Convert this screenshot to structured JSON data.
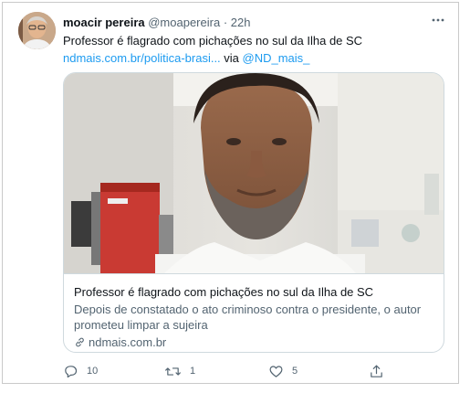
{
  "tweet": {
    "author_name": "moacir pereira",
    "author_handle": "@moapereira",
    "separator": "·",
    "time": "22h",
    "more_icon": "more-horizontal-icon",
    "text_line1": "Professor é flagrado com pichações no sul da Ilha de SC",
    "link_text": "ndmais.com.br/politica-brasi...",
    "via_text": " via ",
    "mention": "@ND_mais_"
  },
  "card": {
    "title": "Professor é flagrado com pichações no sul da Ilha de SC",
    "description": "Depois de constatado o ato criminoso contra o presidente, o autor prometeu limpar a sujeira",
    "domain": "ndmais.com.br",
    "domain_icon": "link-icon"
  },
  "actions": {
    "reply_count": "10",
    "retweet_count": "1",
    "like_count": "5",
    "reply_icon": "reply-icon",
    "retweet_icon": "retweet-icon",
    "like_icon": "heart-icon",
    "share_icon": "share-icon"
  },
  "colors": {
    "link": "#1d9bf0",
    "secondary_text": "#536471",
    "border": "#cfd9de"
  }
}
